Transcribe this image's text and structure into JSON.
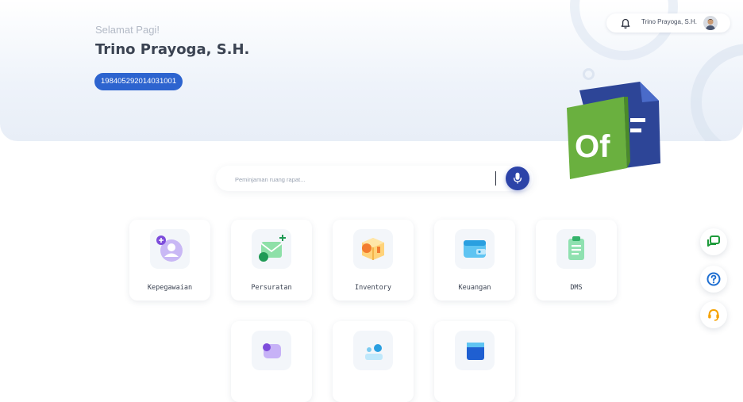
{
  "header": {
    "greeting": "Selamat Pagi!",
    "user_name": "Trino Prayoga, S.H.",
    "nip": "198405292014031001"
  },
  "topbar": {
    "user_chip_name": "Trino Prayoga, S.H.",
    "notification_icon": "bell-icon",
    "avatar": "user-avatar"
  },
  "logo": {
    "text": "Of",
    "icon": "office-logo"
  },
  "search": {
    "placeholder": "Peminjaman ruang rapat...",
    "value": "",
    "voice_icon": "microphone-icon"
  },
  "apps": [
    {
      "label": "Kepegawaian",
      "icon": "employee-icon"
    },
    {
      "label": "Persuratan",
      "icon": "mail-icon"
    },
    {
      "label": "Inventory",
      "icon": "box-icon"
    },
    {
      "label": "Keuangan",
      "icon": "wallet-icon"
    },
    {
      "label": "DMS",
      "icon": "clipboard-icon"
    },
    {
      "label": "",
      "icon": "app-icon"
    },
    {
      "label": "",
      "icon": "app-icon"
    },
    {
      "label": "",
      "icon": "app-icon"
    }
  ],
  "floating_actions": [
    {
      "icon": "chat-icon"
    },
    {
      "icon": "help-icon"
    },
    {
      "icon": "support-icon"
    }
  ],
  "colors": {
    "primary": "#2d64cf",
    "mic": "#2c43a8",
    "fab_green": "#1e9b3b",
    "fab_blue": "#1f6fd1",
    "fab_orange": "#f5a100"
  }
}
